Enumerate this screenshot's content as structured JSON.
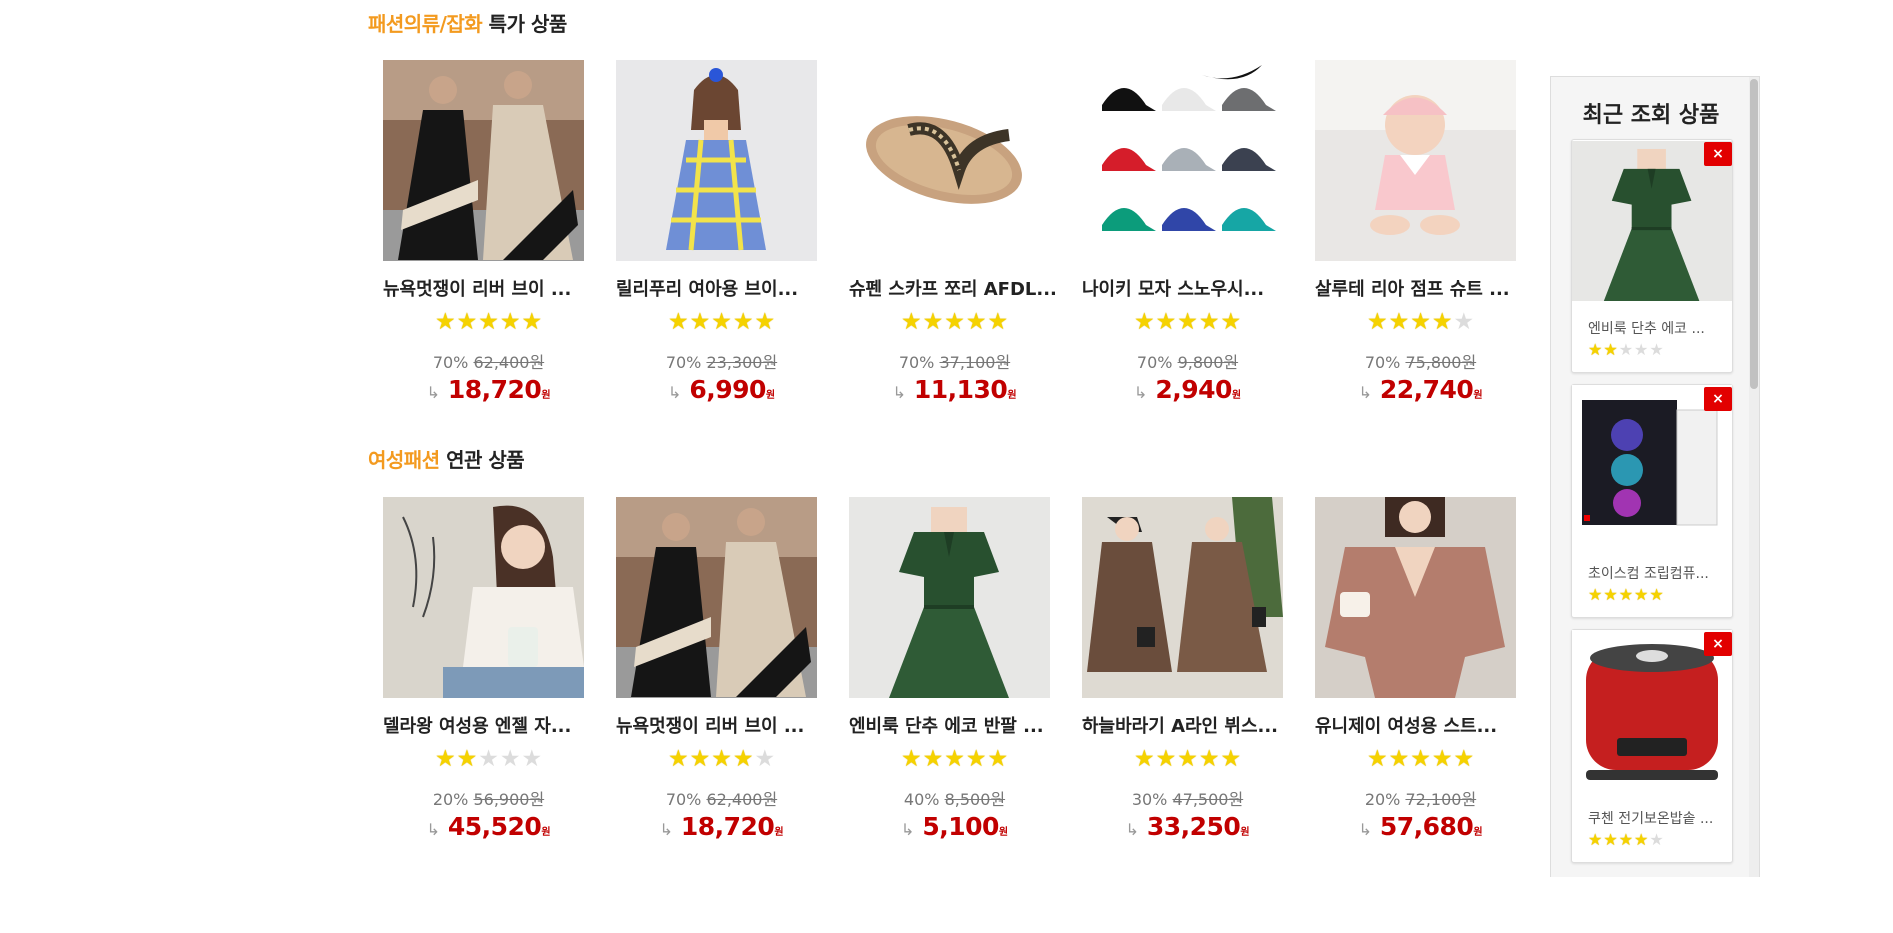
{
  "section1": {
    "title_highlight": "패션의류/잡화",
    "title_rest": " 특가 상품",
    "products": [
      {
        "name": "뉴욕멋쟁이 리버 브이 ...",
        "rating": 5,
        "discount": "70%",
        "original": "62,400원",
        "final": "18,720",
        "unit": "원",
        "image": "dress-image"
      },
      {
        "name": "릴리푸리 여아용 브이...",
        "rating": 5,
        "discount": "70%",
        "original": "23,300원",
        "final": "6,990",
        "unit": "원",
        "image": "girl-dress-image"
      },
      {
        "name": "슈펜 스카프 쪼리 AFDL...",
        "rating": 5,
        "discount": "70%",
        "original": "37,100원",
        "final": "11,130",
        "unit": "원",
        "image": "flip-flop-image"
      },
      {
        "name": "나이키 모자 스노우시...",
        "rating": 5,
        "discount": "70%",
        "original": "9,800원",
        "final": "2,940",
        "unit": "원",
        "image": "caps-image"
      },
      {
        "name": "살루테 리아 점프 슈트 ...",
        "rating": 4,
        "discount": "70%",
        "original": "75,800원",
        "final": "22,740",
        "unit": "원",
        "image": "baby-image"
      }
    ]
  },
  "section2": {
    "title_highlight": "여성패션",
    "title_rest": " 연관 상품",
    "products": [
      {
        "name": "델라왕 여성용 엔젤 자...",
        "rating": 2,
        "discount": "20%",
        "original": "56,900원",
        "final": "45,520",
        "unit": "원",
        "image": "blouse-image"
      },
      {
        "name": "뉴욕멋쟁이 리버 브이 ...",
        "rating": 4,
        "discount": "70%",
        "original": "62,400원",
        "final": "18,720",
        "unit": "원",
        "image": "dress-image"
      },
      {
        "name": "엔비룩 단추 에코 반팔 ...",
        "rating": 5,
        "discount": "40%",
        "original": "8,500원",
        "final": "5,100",
        "unit": "원",
        "image": "green-dress-image"
      },
      {
        "name": "하늘바라기 A라인 뷔스...",
        "rating": 5,
        "discount": "30%",
        "original": "47,500원",
        "final": "33,250",
        "unit": "원",
        "image": "aline-dress-image"
      },
      {
        "name": "유니제이 여성용 스트...",
        "rating": 5,
        "discount": "20%",
        "original": "72,100원",
        "final": "57,680",
        "unit": "원",
        "image": "pink-blouse-image"
      }
    ]
  },
  "sidebar": {
    "title": "최근 조회 상품",
    "close_label": "×",
    "items": [
      {
        "name": "엔비룩 단추 에코 ...",
        "rating": 2,
        "image": "green-dress-image"
      },
      {
        "name": "초이스컴 조립컴퓨...",
        "rating": 5,
        "image": "pc-case-image"
      },
      {
        "name": "쿠첸 전기보온밥솥 ...",
        "rating": 4,
        "image": "rice-cooker-image"
      }
    ]
  },
  "colors": {
    "accent": "#f39a1f",
    "price": "#c10000",
    "star": "#f5d200",
    "close": "#e20000"
  }
}
